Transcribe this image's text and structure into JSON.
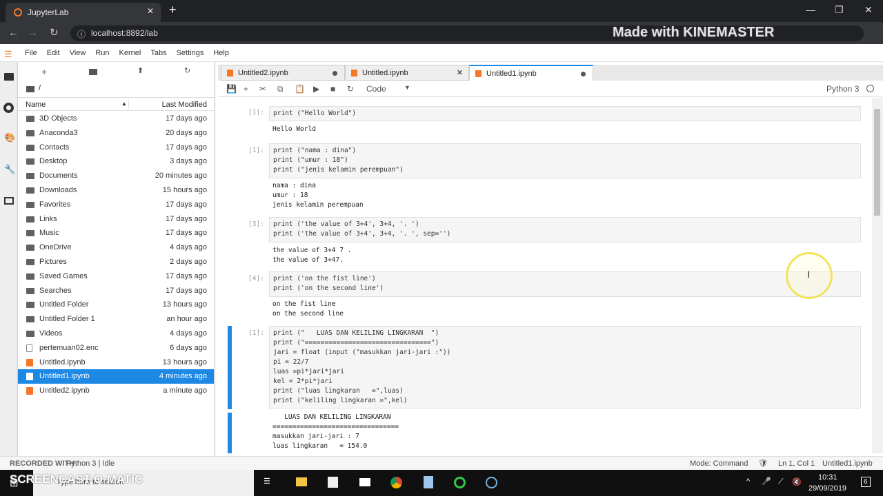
{
  "browser": {
    "tab_title": "JupyterLab",
    "url": "localhost:8892/lab"
  },
  "watermarks": {
    "top": "Made with KINEMASTER",
    "recorded": "RECORDED WITH",
    "screencast": "SCREENCAST-O-MATIC"
  },
  "menu": [
    "File",
    "Edit",
    "View",
    "Run",
    "Kernel",
    "Tabs",
    "Settings",
    "Help"
  ],
  "filebrowser": {
    "path": "/",
    "col_name": "Name",
    "col_modified": "Last Modified",
    "items": [
      {
        "name": "3D Objects",
        "modified": "17 days ago",
        "type": "folder"
      },
      {
        "name": "Anaconda3",
        "modified": "20 days ago",
        "type": "folder"
      },
      {
        "name": "Contacts",
        "modified": "17 days ago",
        "type": "folder"
      },
      {
        "name": "Desktop",
        "modified": "3 days ago",
        "type": "folder"
      },
      {
        "name": "Documents",
        "modified": "20 minutes ago",
        "type": "folder"
      },
      {
        "name": "Downloads",
        "modified": "15 hours ago",
        "type": "folder"
      },
      {
        "name": "Favorites",
        "modified": "17 days ago",
        "type": "folder"
      },
      {
        "name": "Links",
        "modified": "17 days ago",
        "type": "folder"
      },
      {
        "name": "Music",
        "modified": "17 days ago",
        "type": "folder"
      },
      {
        "name": "OneDrive",
        "modified": "4 days ago",
        "type": "folder"
      },
      {
        "name": "Pictures",
        "modified": "2 days ago",
        "type": "folder"
      },
      {
        "name": "Saved Games",
        "modified": "17 days ago",
        "type": "folder"
      },
      {
        "name": "Searches",
        "modified": "17 days ago",
        "type": "folder"
      },
      {
        "name": "Untitled Folder",
        "modified": "13 hours ago",
        "type": "folder"
      },
      {
        "name": "Untitled Folder 1",
        "modified": "an hour ago",
        "type": "folder"
      },
      {
        "name": "Videos",
        "modified": "4 days ago",
        "type": "folder"
      },
      {
        "name": "pertemuan02.enc",
        "modified": "6 days ago",
        "type": "file"
      },
      {
        "name": "Untitled.ipynb",
        "modified": "13 hours ago",
        "type": "notebook"
      },
      {
        "name": "Untitled1.ipynb",
        "modified": "4 minutes ago",
        "type": "notebook",
        "selected": true
      },
      {
        "name": "Untitled2.ipynb",
        "modified": "a minute ago",
        "type": "notebook"
      }
    ]
  },
  "tabs": [
    {
      "label": "Untitled2.ipynb"
    },
    {
      "label": "Untitled.ipynb"
    },
    {
      "label": "Untitled1.ipynb"
    }
  ],
  "toolbar": {
    "cell_type": "Code",
    "kernel": "Python 3"
  },
  "cells": [
    {
      "prompt": "[1]:",
      "code": "print (\"Hello World\")",
      "output": "Hello World"
    },
    {
      "prompt": "[1]:",
      "code": "print (\"nama : dina\")\nprint (\"umur : 18\")\nprint (\"jenis kelamin perempuan\")",
      "output": "nama : dina\numur : 18\njenis kelamin perempuan"
    },
    {
      "prompt": "[3]:",
      "code": "print ('the value of 3+4', 3+4, '. ')\nprint ('the value of 3+4', 3+4, '. ', sep='')",
      "output": "the value of 3+4 7 .\nthe value of 3+47."
    },
    {
      "prompt": "[4]:",
      "code": "print ('on the fist line')\nprint ('on the second line')",
      "output": "on the fist line\non the second line"
    },
    {
      "prompt": "[1]:",
      "code": "print (\"   LUAS DAN KELILING LINGKARAN  \")\nprint (\"================================\")\njari = float (input (\"masukkan jari-jari :\"))\npi = 22/7\nluas =pi*jari*jari\nkel = 2*pi*jari\nprint (\"luas lingkaran   =\",luas)\nprint (\"keliling lingkaran =\",kel)",
      "output": "   LUAS DAN KELILING LINGKARAN\n================================\nmasukkan jari-jari : 7\nluas lingkaran   = 154.0"
    }
  ],
  "status": {
    "left": "Python 3 | Idle",
    "mode": "Mode: Command",
    "position": "Ln 1, Col 1",
    "file": "Untitled1.ipynb"
  },
  "taskbar": {
    "search": "Type here to search",
    "time": "10:31",
    "date": "29/09/2019",
    "notifications": "6"
  }
}
